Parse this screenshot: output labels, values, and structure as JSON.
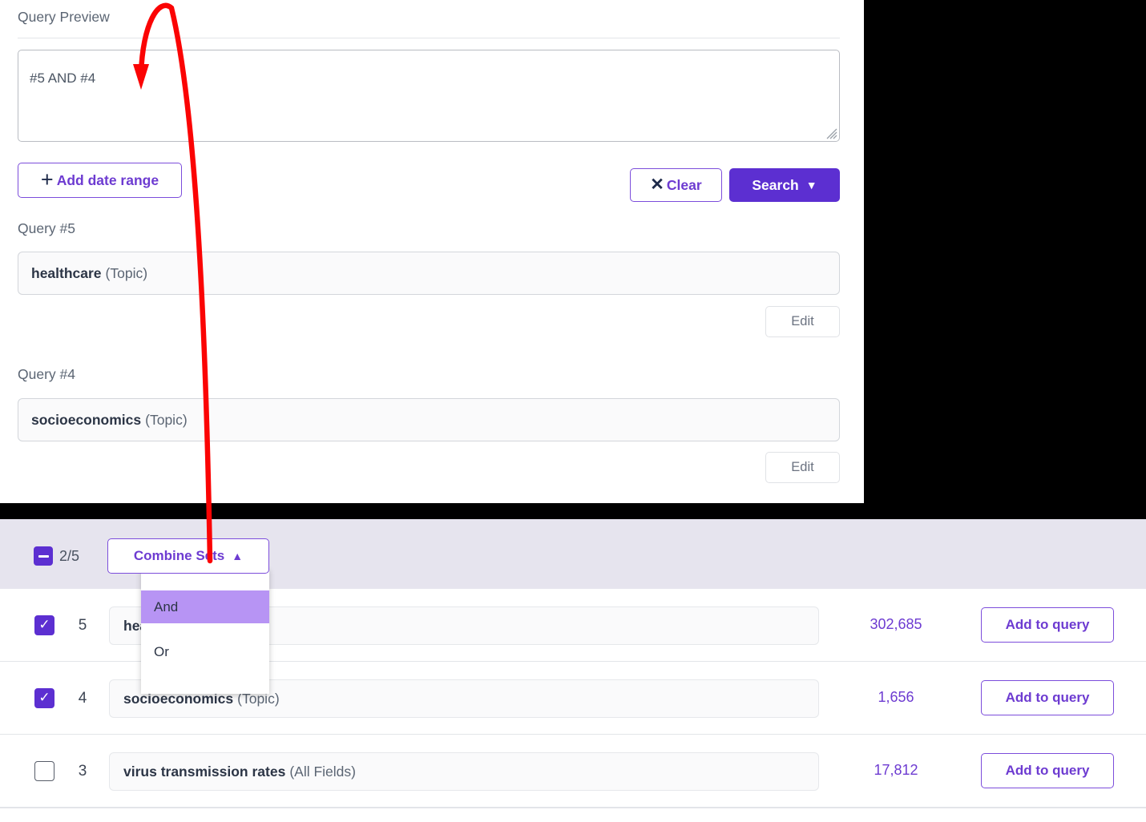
{
  "colors": {
    "brand_purple": "#5c2fd1",
    "brand_purple_text": "#6d3bd1",
    "menu_highlight": "#b794f4",
    "toolbar_lavender": "#e6e4ee",
    "annotation_red": "#fb0404",
    "page_background": "#000000"
  },
  "query_builder": {
    "preview_label": "Query Preview",
    "preview_textarea_value": "#5 AND #4",
    "preview_textarea_placeholder": "",
    "add_date_range_label": "Add date range",
    "add_date_range_icon": "plus-icon",
    "clear_label": "Clear",
    "clear_icon": "close-x-icon",
    "search_label": "Search",
    "search_chevron_icon": "chevron-down-icon",
    "resize_handle_icon": "resize-grip-icon",
    "blocks": [
      {
        "label": "Query #5",
        "term": "healthcare",
        "scope": "(Topic)",
        "edit_label": "Edit"
      },
      {
        "label": "Query #4",
        "term": "socioeconomics",
        "scope": "(Topic)",
        "edit_label": "Edit"
      }
    ]
  },
  "sets_panel": {
    "toolbar": {
      "select_all_state": "indeterminate",
      "select_all_icon": "minus-square-icon",
      "selected_count": "2/5",
      "combine_sets_label": "Combine Sets",
      "combine_sets_chevron_icon": "chevron-up-icon",
      "menu_open": true,
      "menu_items": [
        {
          "label": "And",
          "highlighted": true
        },
        {
          "label": "Or",
          "highlighted": false
        }
      ]
    },
    "add_to_query_label": "Add to query",
    "rows": [
      {
        "checked": true,
        "number": "5",
        "term": "healthcare",
        "scope": "(Topic)",
        "count": "302,685",
        "action_label": "Add to query"
      },
      {
        "checked": true,
        "number": "4",
        "term": "socioeconomics",
        "scope": "(Topic)",
        "count": "1,656",
        "action_label": "Add to query"
      },
      {
        "checked": false,
        "number": "3",
        "term": "virus transmission rates",
        "scope": "(All Fields)",
        "count": "17,812",
        "action_label": "Add to query"
      }
    ]
  },
  "annotation": {
    "type": "curved-arrow",
    "color": "#fb0404",
    "from_label": "Combine Sets menu",
    "to_label": "Query Preview textarea"
  }
}
